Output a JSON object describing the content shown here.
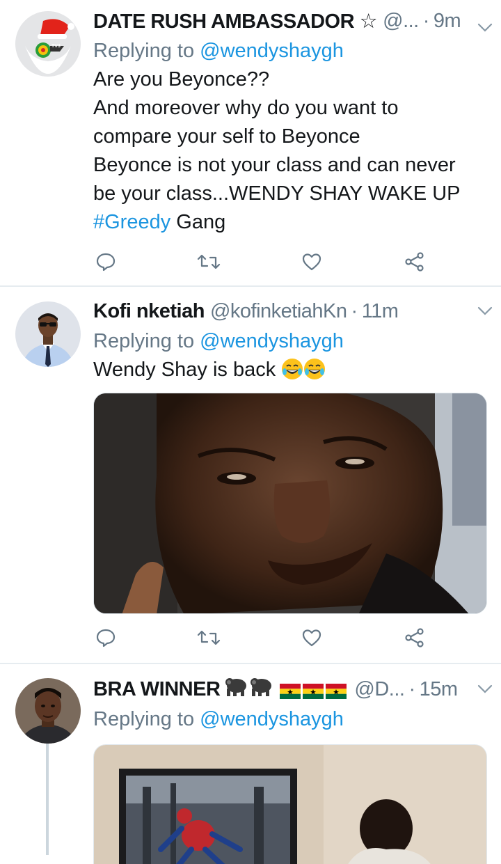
{
  "tweets": [
    {
      "name": "DATE RUSH AMBASSADOR ☆",
      "handle": "@...",
      "time": "9m",
      "reply_prefix": "Replying to",
      "reply_to": "@wendyshaygh",
      "lines": [
        "Are you Beyonce??",
        "And moreover why do you want to",
        "compare  your self to Beyonce",
        "Beyonce is not your class and can never",
        "be your class...WENDY SHAY WAKE UP"
      ],
      "hashtag": "#Greedy",
      "hashtag_tail": " Gang",
      "avatar_badge": "TV3"
    },
    {
      "name": "Kofi nketiah",
      "handle": "@kofinketiahKn",
      "time": "11m",
      "reply_prefix": "Replying to",
      "reply_to": "@wendyshaygh",
      "text": "Wendy Shay is back"
    },
    {
      "name": "BRA WINNER",
      "handle": "@D...",
      "time": "15m",
      "reply_prefix": "Replying to",
      "reply_to": "@wendyshaygh"
    }
  ],
  "icons": {
    "reply": "reply-icon",
    "retweet": "retweet-icon",
    "like": "heart-icon",
    "share": "share-icon",
    "more": "chevron-down-icon"
  },
  "colors": {
    "link": "#1b95e0",
    "muted": "#657786",
    "divider": "#e6ecf0"
  }
}
